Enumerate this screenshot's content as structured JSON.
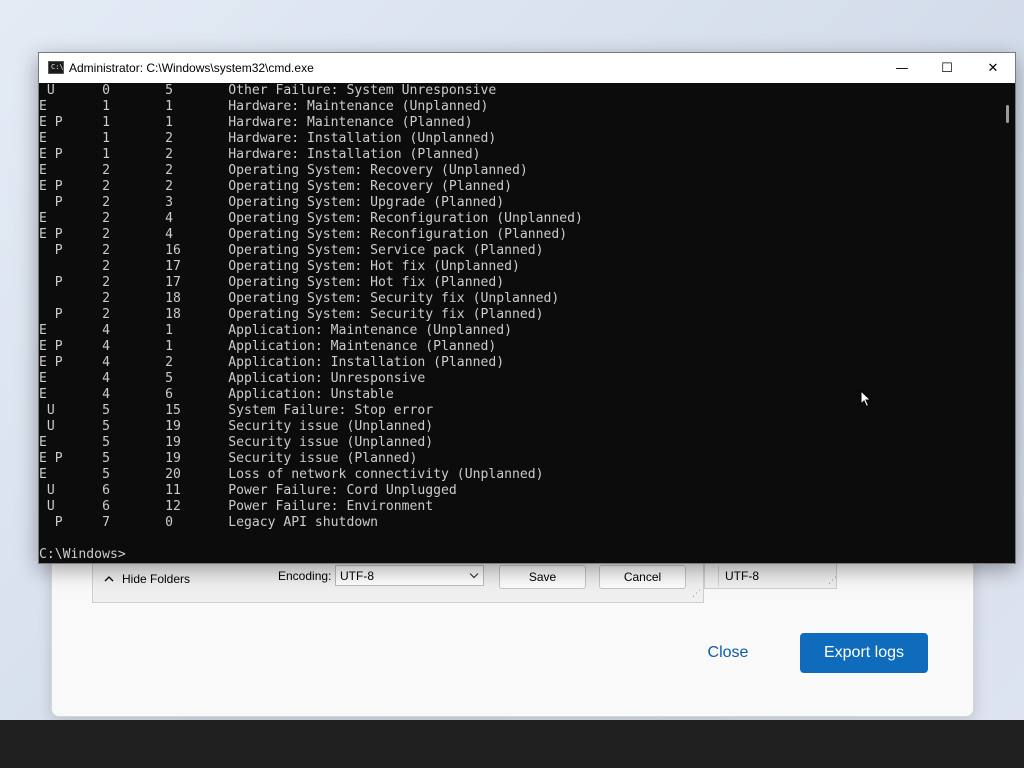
{
  "cmd": {
    "title": "Administrator: C:\\Windows\\system32\\cmd.exe",
    "icon": "cmd-icon",
    "icon_glyph": "C:\\",
    "controls": {
      "minimize": "—",
      "maximize": "☐",
      "close": "✕"
    },
    "lines": [
      " U      0       5       Other Failure: System Unresponsive",
      "E       1       1       Hardware: Maintenance (Unplanned)",
      "E P     1       1       Hardware: Maintenance (Planned)",
      "E       1       2       Hardware: Installation (Unplanned)",
      "E P     1       2       Hardware: Installation (Planned)",
      "E       2       2       Operating System: Recovery (Unplanned)",
      "E P     2       2       Operating System: Recovery (Planned)",
      "  P     2       3       Operating System: Upgrade (Planned)",
      "E       2       4       Operating System: Reconfiguration (Unplanned)",
      "E P     2       4       Operating System: Reconfiguration (Planned)",
      "  P     2       16      Operating System: Service pack (Planned)",
      "        2       17      Operating System: Hot fix (Unplanned)",
      "  P     2       17      Operating System: Hot fix (Planned)",
      "        2       18      Operating System: Security fix (Unplanned)",
      "  P     2       18      Operating System: Security fix (Planned)",
      "E       4       1       Application: Maintenance (Unplanned)",
      "E P     4       1       Application: Maintenance (Planned)",
      "E P     4       2       Application: Installation (Planned)",
      "E       4       5       Application: Unresponsive",
      "E       4       6       Application: Unstable",
      " U      5       15      System Failure: Stop error",
      " U      5       19      Security issue (Unplanned)",
      "E       5       19      Security issue (Unplanned)",
      "E P     5       19      Security issue (Planned)",
      "E       5       20      Loss of network connectivity (Unplanned)",
      " U      6       11      Power Failure: Cord Unplugged",
      " U      6       12      Power Failure: Environment",
      "  P     7       0       Legacy API shutdown",
      "",
      "C:\\Windows>"
    ]
  },
  "save_dialog": {
    "hide_folders_label": "Hide Folders",
    "hide_folders_icon": "chevron-up-icon",
    "encoding_label": "Encoding:",
    "encoding_value": "UTF-8",
    "save_label": "Save",
    "cancel_label": "Cancel",
    "aux_encoding_value": "UTF-8"
  },
  "export_dialog": {
    "close_label": "Close",
    "export_label": "Export logs",
    "accent_color": "#0f6cbd"
  }
}
